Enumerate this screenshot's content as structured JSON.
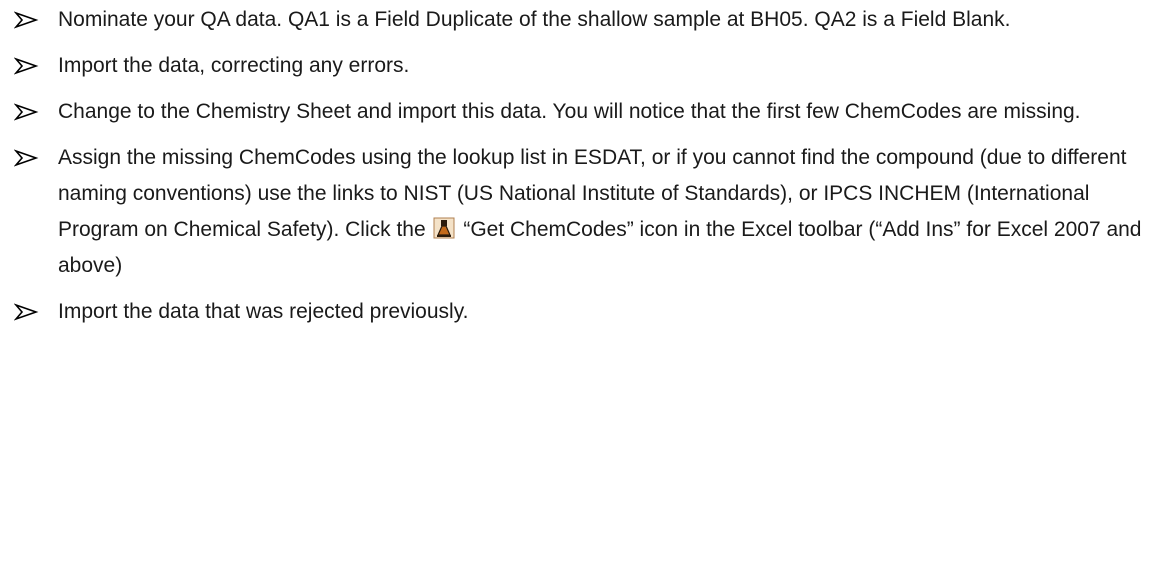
{
  "bullets": [
    {
      "text": "Nominate your QA data.  QA1 is a Field Duplicate of the shallow sample at BH05. QA2 is a Field Blank."
    },
    {
      "text": "Import the data, correcting any errors."
    },
    {
      "text": "Change to the Chemistry Sheet and import this data.  You will notice that the first few ChemCodes are missing."
    },
    {
      "text_before_icon": "Assign the missing ChemCodes using the lookup list in ESDAT, or if you cannot find the compound (due to different naming conventions) use the links to NIST (US National Institute of Standards), or IPCS INCHEM (International Program on Chemical Safety).  Click the",
      "icon": "chemcodes-flask-icon",
      "text_after_icon": "“Get ChemCodes” icon in the Excel toolbar (“Add Ins” for Excel 2007 and above)"
    },
    {
      "text": "Import the data that was rejected previously."
    }
  ],
  "colors": {
    "text": "#1a1a1a",
    "arrow": "#000000",
    "icon_body": "#c46a1a",
    "icon_dark": "#2b1a0a"
  }
}
